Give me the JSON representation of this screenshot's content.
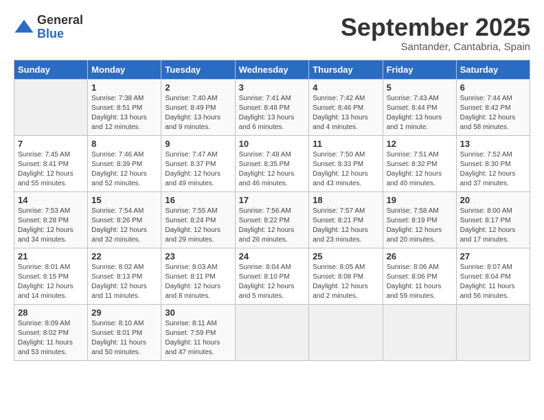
{
  "logo": {
    "general": "General",
    "blue": "Blue"
  },
  "title": "September 2025",
  "subtitle": "Santander, Cantabria, Spain",
  "days_header": [
    "Sunday",
    "Monday",
    "Tuesday",
    "Wednesday",
    "Thursday",
    "Friday",
    "Saturday"
  ],
  "weeks": [
    [
      {
        "day": "",
        "info": ""
      },
      {
        "day": "1",
        "info": "Sunrise: 7:38 AM\nSunset: 8:51 PM\nDaylight: 13 hours\nand 12 minutes."
      },
      {
        "day": "2",
        "info": "Sunrise: 7:40 AM\nSunset: 8:49 PM\nDaylight: 13 hours\nand 9 minutes."
      },
      {
        "day": "3",
        "info": "Sunrise: 7:41 AM\nSunset: 8:48 PM\nDaylight: 13 hours\nand 6 minutes."
      },
      {
        "day": "4",
        "info": "Sunrise: 7:42 AM\nSunset: 8:46 PM\nDaylight: 13 hours\nand 4 minutes."
      },
      {
        "day": "5",
        "info": "Sunrise: 7:43 AM\nSunset: 8:44 PM\nDaylight: 13 hours\nand 1 minute."
      },
      {
        "day": "6",
        "info": "Sunrise: 7:44 AM\nSunset: 8:42 PM\nDaylight: 12 hours\nand 58 minutes."
      }
    ],
    [
      {
        "day": "7",
        "info": "Sunrise: 7:45 AM\nSunset: 8:41 PM\nDaylight: 12 hours\nand 55 minutes."
      },
      {
        "day": "8",
        "info": "Sunrise: 7:46 AM\nSunset: 8:39 PM\nDaylight: 12 hours\nand 52 minutes."
      },
      {
        "day": "9",
        "info": "Sunrise: 7:47 AM\nSunset: 8:37 PM\nDaylight: 12 hours\nand 49 minutes."
      },
      {
        "day": "10",
        "info": "Sunrise: 7:48 AM\nSunset: 8:35 PM\nDaylight: 12 hours\nand 46 minutes."
      },
      {
        "day": "11",
        "info": "Sunrise: 7:50 AM\nSunset: 8:33 PM\nDaylight: 12 hours\nand 43 minutes."
      },
      {
        "day": "12",
        "info": "Sunrise: 7:51 AM\nSunset: 8:32 PM\nDaylight: 12 hours\nand 40 minutes."
      },
      {
        "day": "13",
        "info": "Sunrise: 7:52 AM\nSunset: 8:30 PM\nDaylight: 12 hours\nand 37 minutes."
      }
    ],
    [
      {
        "day": "14",
        "info": "Sunrise: 7:53 AM\nSunset: 8:28 PM\nDaylight: 12 hours\nand 34 minutes."
      },
      {
        "day": "15",
        "info": "Sunrise: 7:54 AM\nSunset: 8:26 PM\nDaylight: 12 hours\nand 32 minutes."
      },
      {
        "day": "16",
        "info": "Sunrise: 7:55 AM\nSunset: 8:24 PM\nDaylight: 12 hours\nand 29 minutes."
      },
      {
        "day": "17",
        "info": "Sunrise: 7:56 AM\nSunset: 8:22 PM\nDaylight: 12 hours\nand 26 minutes."
      },
      {
        "day": "18",
        "info": "Sunrise: 7:57 AM\nSunset: 8:21 PM\nDaylight: 12 hours\nand 23 minutes."
      },
      {
        "day": "19",
        "info": "Sunrise: 7:58 AM\nSunset: 8:19 PM\nDaylight: 12 hours\nand 20 minutes."
      },
      {
        "day": "20",
        "info": "Sunrise: 8:00 AM\nSunset: 8:17 PM\nDaylight: 12 hours\nand 17 minutes."
      }
    ],
    [
      {
        "day": "21",
        "info": "Sunrise: 8:01 AM\nSunset: 8:15 PM\nDaylight: 12 hours\nand 14 minutes."
      },
      {
        "day": "22",
        "info": "Sunrise: 8:02 AM\nSunset: 8:13 PM\nDaylight: 12 hours\nand 11 minutes."
      },
      {
        "day": "23",
        "info": "Sunrise: 8:03 AM\nSunset: 8:11 PM\nDaylight: 12 hours\nand 8 minutes."
      },
      {
        "day": "24",
        "info": "Sunrise: 8:04 AM\nSunset: 8:10 PM\nDaylight: 12 hours\nand 5 minutes."
      },
      {
        "day": "25",
        "info": "Sunrise: 8:05 AM\nSunset: 8:08 PM\nDaylight: 12 hours\nand 2 minutes."
      },
      {
        "day": "26",
        "info": "Sunrise: 8:06 AM\nSunset: 8:06 PM\nDaylight: 11 hours\nand 59 minutes."
      },
      {
        "day": "27",
        "info": "Sunrise: 8:07 AM\nSunset: 8:04 PM\nDaylight: 11 hours\nand 56 minutes."
      }
    ],
    [
      {
        "day": "28",
        "info": "Sunrise: 8:09 AM\nSunset: 8:02 PM\nDaylight: 11 hours\nand 53 minutes."
      },
      {
        "day": "29",
        "info": "Sunrise: 8:10 AM\nSunset: 8:01 PM\nDaylight: 11 hours\nand 50 minutes."
      },
      {
        "day": "30",
        "info": "Sunrise: 8:11 AM\nSunset: 7:59 PM\nDaylight: 11 hours\nand 47 minutes."
      },
      {
        "day": "",
        "info": ""
      },
      {
        "day": "",
        "info": ""
      },
      {
        "day": "",
        "info": ""
      },
      {
        "day": "",
        "info": ""
      }
    ]
  ]
}
